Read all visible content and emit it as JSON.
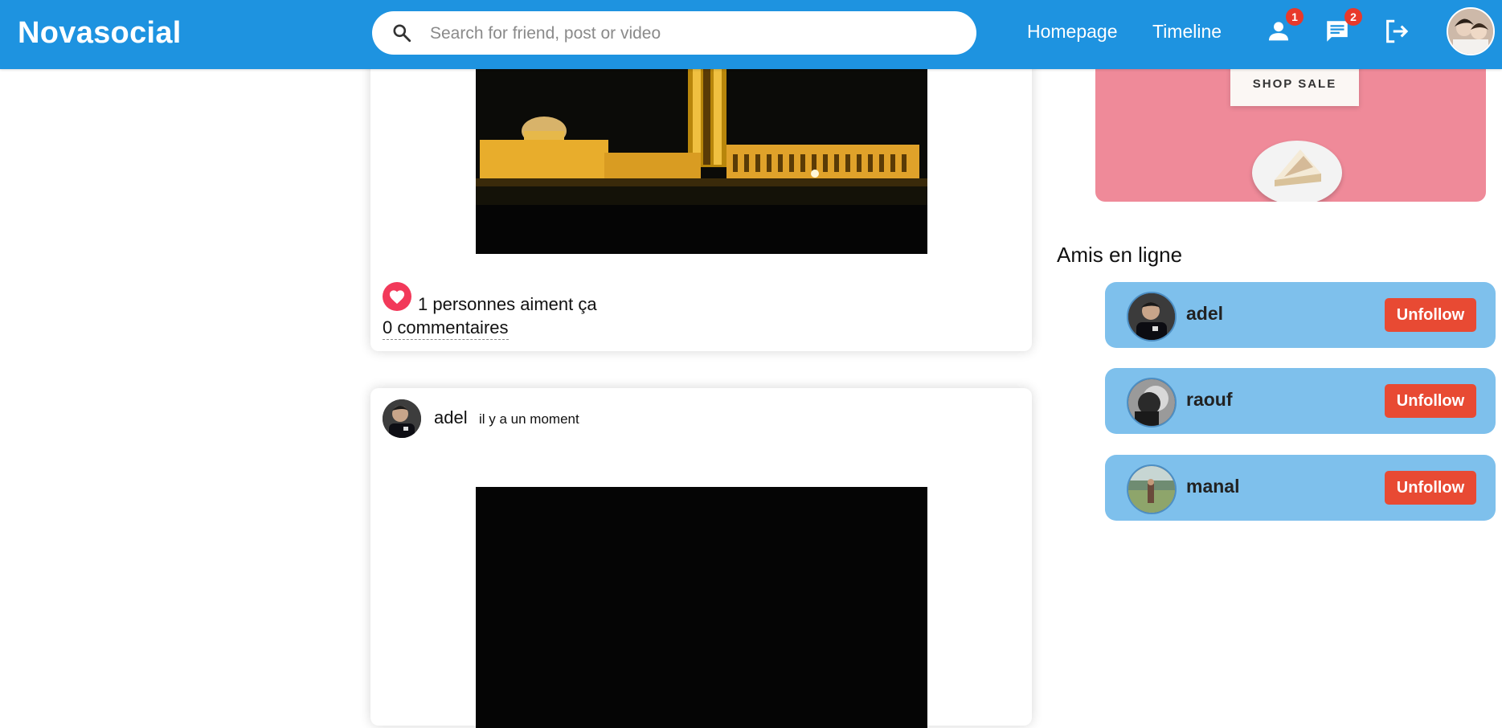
{
  "brand": {
    "name": "Novasocial",
    "color": "#1e93e0"
  },
  "search": {
    "placeholder": "Search for friend, post or video",
    "value": ""
  },
  "nav": {
    "links": [
      "Homepage",
      "Timeline"
    ],
    "friend_requests_badge": "1",
    "messages_badge": "2"
  },
  "posts": [
    {
      "likes_text": "1 personnes aiment ça",
      "comments_text": "0 commentaires"
    },
    {
      "username": "adel",
      "time": "il y a un moment"
    }
  ],
  "ad": {
    "cta": "SHOP SALE"
  },
  "sidebar": {
    "title": "Amis en ligne",
    "friends": [
      {
        "name": "adel",
        "button": "Unfollow"
      },
      {
        "name": "raouf",
        "button": "Unfollow"
      },
      {
        "name": "manal",
        "button": "Unfollow"
      }
    ]
  },
  "colors": {
    "friend_card": "#7ec0ec",
    "unfollow_button": "#e84a33",
    "like_heart": "#f2395a",
    "badge": "#e8392b",
    "ad_background": "#ef8a99"
  },
  "icons": [
    "search-icon",
    "person-icon",
    "chat-icon",
    "logout-icon",
    "heart-icon"
  ]
}
